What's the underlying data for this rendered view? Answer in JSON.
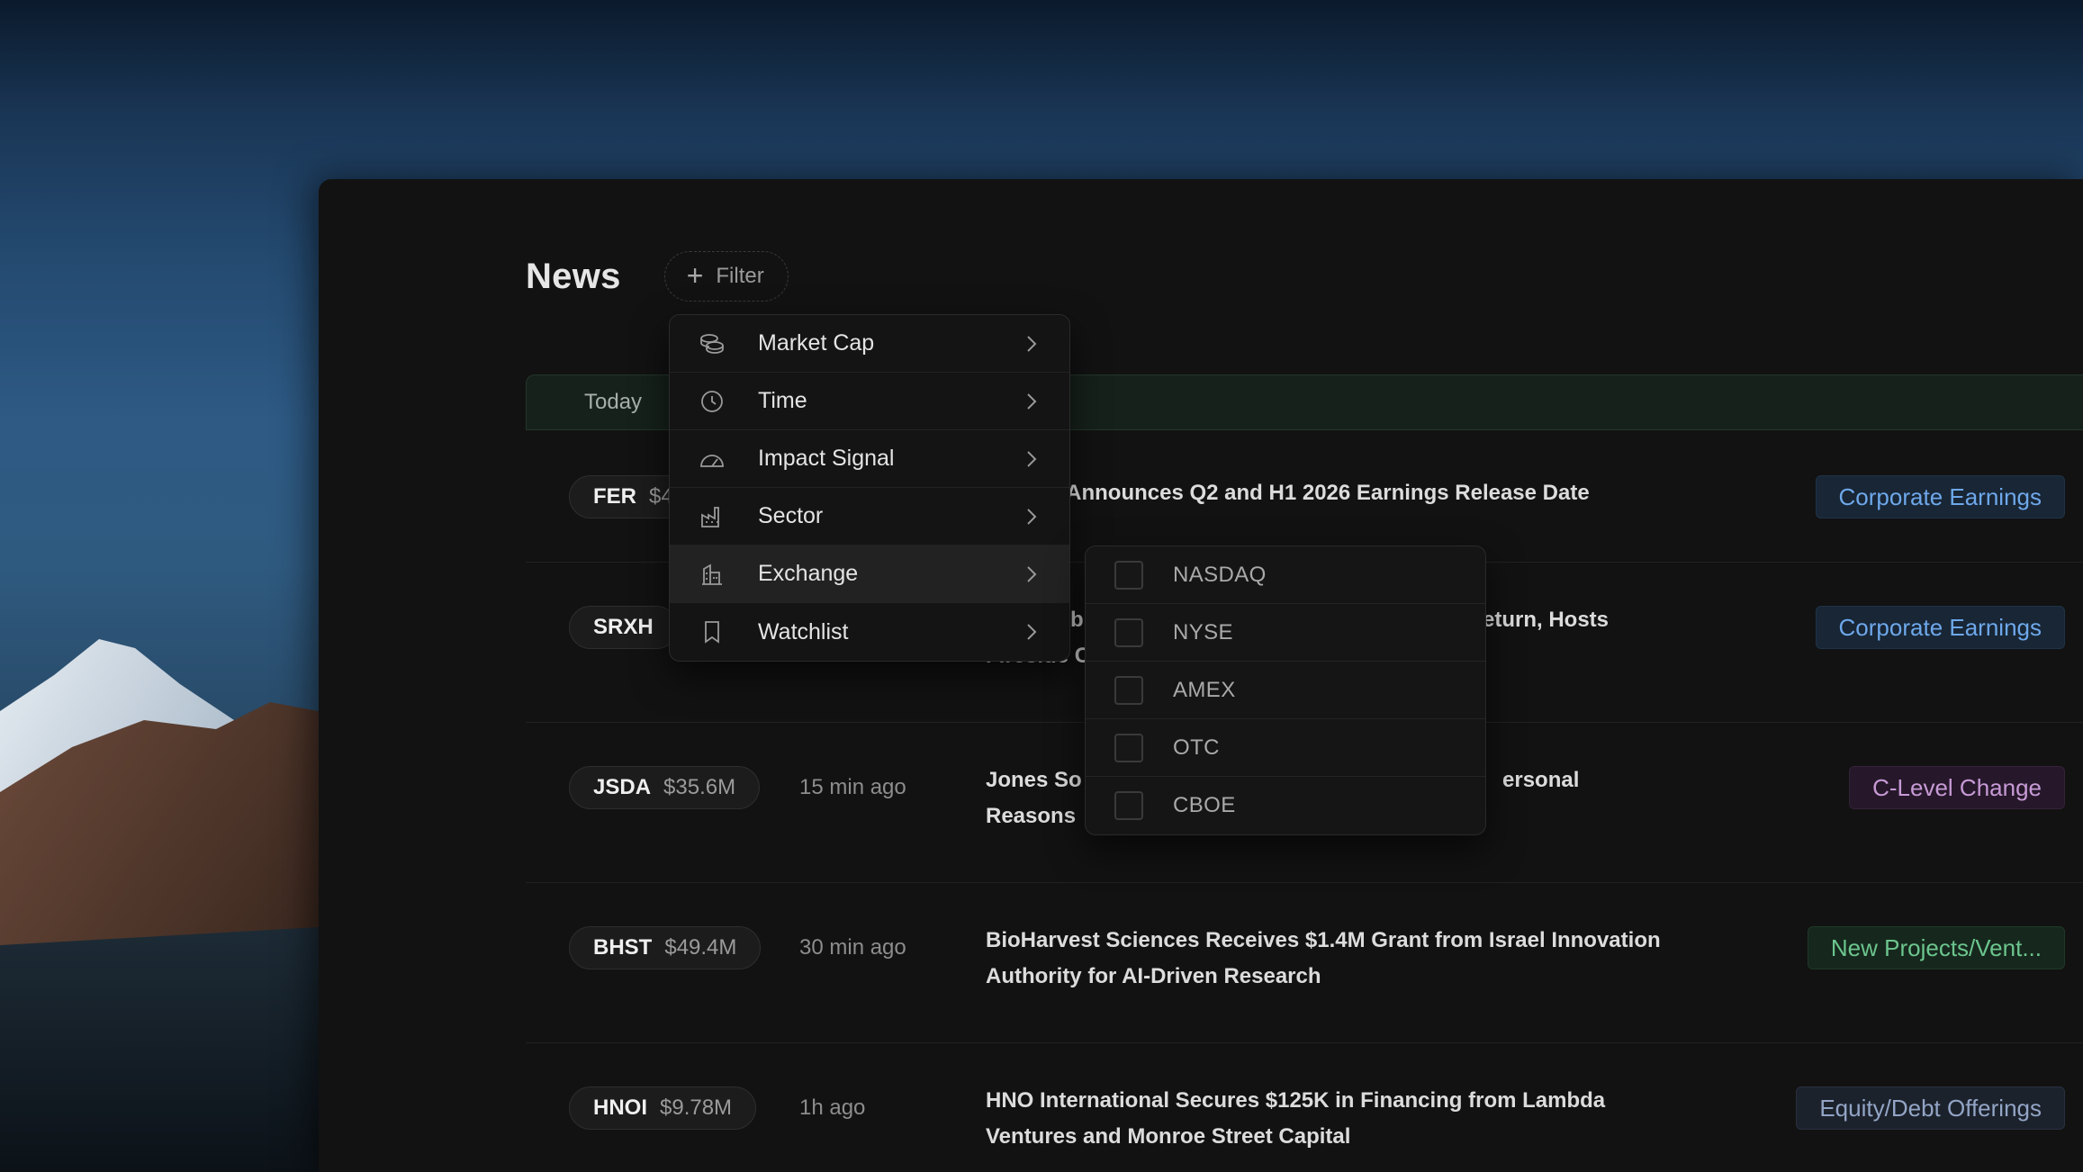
{
  "page": {
    "title": "News",
    "filter_label": "Filter"
  },
  "date_group": "Today",
  "rows": [
    {
      "symbol": "FER",
      "market_cap": "$4",
      "time": "",
      "headline": "l SE Announces Q2 and H1 2026 Earnings Release Date",
      "tag": "Corporate Earnings"
    },
    {
      "symbol": "SRXH",
      "market_cap": "",
      "time": "",
      "headline_line1_left": "b",
      "headline_line1_right": "eturn, Hosts",
      "headline_line2": "Fireside C",
      "tag": "Corporate Earnings"
    },
    {
      "symbol": "JSDA",
      "market_cap": "$35.6M",
      "time": "15 min ago",
      "headline_line1_left": "Jones So",
      "headline_line1_right": "ersonal",
      "headline_line2": "Reasons",
      "tag": "C-Level Change"
    },
    {
      "symbol": "BHST",
      "market_cap": "$49.4M",
      "time": "30 min ago",
      "headline": "BioHarvest Sciences Receives $1.4M Grant from Israel Innovation Authority for AI-Driven Research",
      "tag": "New Projects/Vent..."
    },
    {
      "symbol": "HNOI",
      "market_cap": "$9.78M",
      "time": "1h ago",
      "headline": "HNO International Secures $125K in Financing from Lambda Ventures and Monroe Street Capital",
      "tag": "Equity/Debt Offerings"
    }
  ],
  "filter_menu": {
    "items": [
      {
        "label": "Market Cap",
        "icon": "coins-icon"
      },
      {
        "label": "Time",
        "icon": "clock-icon"
      },
      {
        "label": "Impact Signal",
        "icon": "gauge-icon"
      },
      {
        "label": "Sector",
        "icon": "factory-icon"
      },
      {
        "label": "Exchange",
        "icon": "building-icon"
      },
      {
        "label": "Watchlist",
        "icon": "bookmark-icon"
      }
    ],
    "active_item": "Exchange"
  },
  "exchange_submenu": {
    "options": [
      {
        "label": "NASDAQ",
        "checked": false
      },
      {
        "label": "NYSE",
        "checked": false
      },
      {
        "label": "AMEX",
        "checked": false
      },
      {
        "label": "OTC",
        "checked": false
      },
      {
        "label": "CBOE",
        "checked": false
      }
    ]
  },
  "colors": {
    "earnings_tag": "#6ea8ea",
    "clevel_tag": "#c79ad6",
    "projects_tag": "#6cc58e",
    "equity_tag": "#93a5c6",
    "window_bg": "#121212"
  }
}
